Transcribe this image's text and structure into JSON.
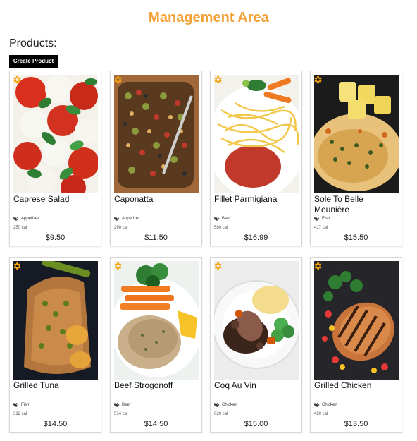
{
  "page": {
    "title": "Management Area",
    "products_heading": "Products:",
    "create_button": "Create Product"
  },
  "colors": {
    "title": "#f3a23a",
    "gear": "#f5a20b",
    "button_bg": "#000000"
  },
  "products": [
    {
      "name": "Caprese Salad",
      "category": "Appetizer",
      "calories": "250 cal",
      "price": "$9.50",
      "icon": "gear-icon"
    },
    {
      "name": "Caponatta",
      "category": "Appetizer",
      "calories": "290 cal",
      "price": "$11.50",
      "icon": "gear-icon"
    },
    {
      "name": "Fillet Parmigiana",
      "category": "Beef",
      "calories": "580 cal",
      "price": "$16.99",
      "icon": "gear-icon"
    },
    {
      "name": "Sole To Belle Meunière",
      "category": "Fish",
      "calories": "417 cal",
      "price": "$15.50",
      "icon": "gear-icon"
    },
    {
      "name": "Grilled Tuna",
      "category": "Fish",
      "calories": "312 cal",
      "price": "$14.50",
      "icon": "gear-icon"
    },
    {
      "name": "Beef Strogonoff",
      "category": "Beef",
      "calories": "514 cal",
      "price": "$14.50",
      "icon": "gear-icon"
    },
    {
      "name": "Coq Au Vin",
      "category": "Chicken",
      "calories": "620 cal",
      "price": "$15.00",
      "icon": "gear-icon"
    },
    {
      "name": "Grilled Chicken",
      "category": "Chicken",
      "calories": "420 cal",
      "price": "$13.50",
      "icon": "gear-icon"
    }
  ]
}
